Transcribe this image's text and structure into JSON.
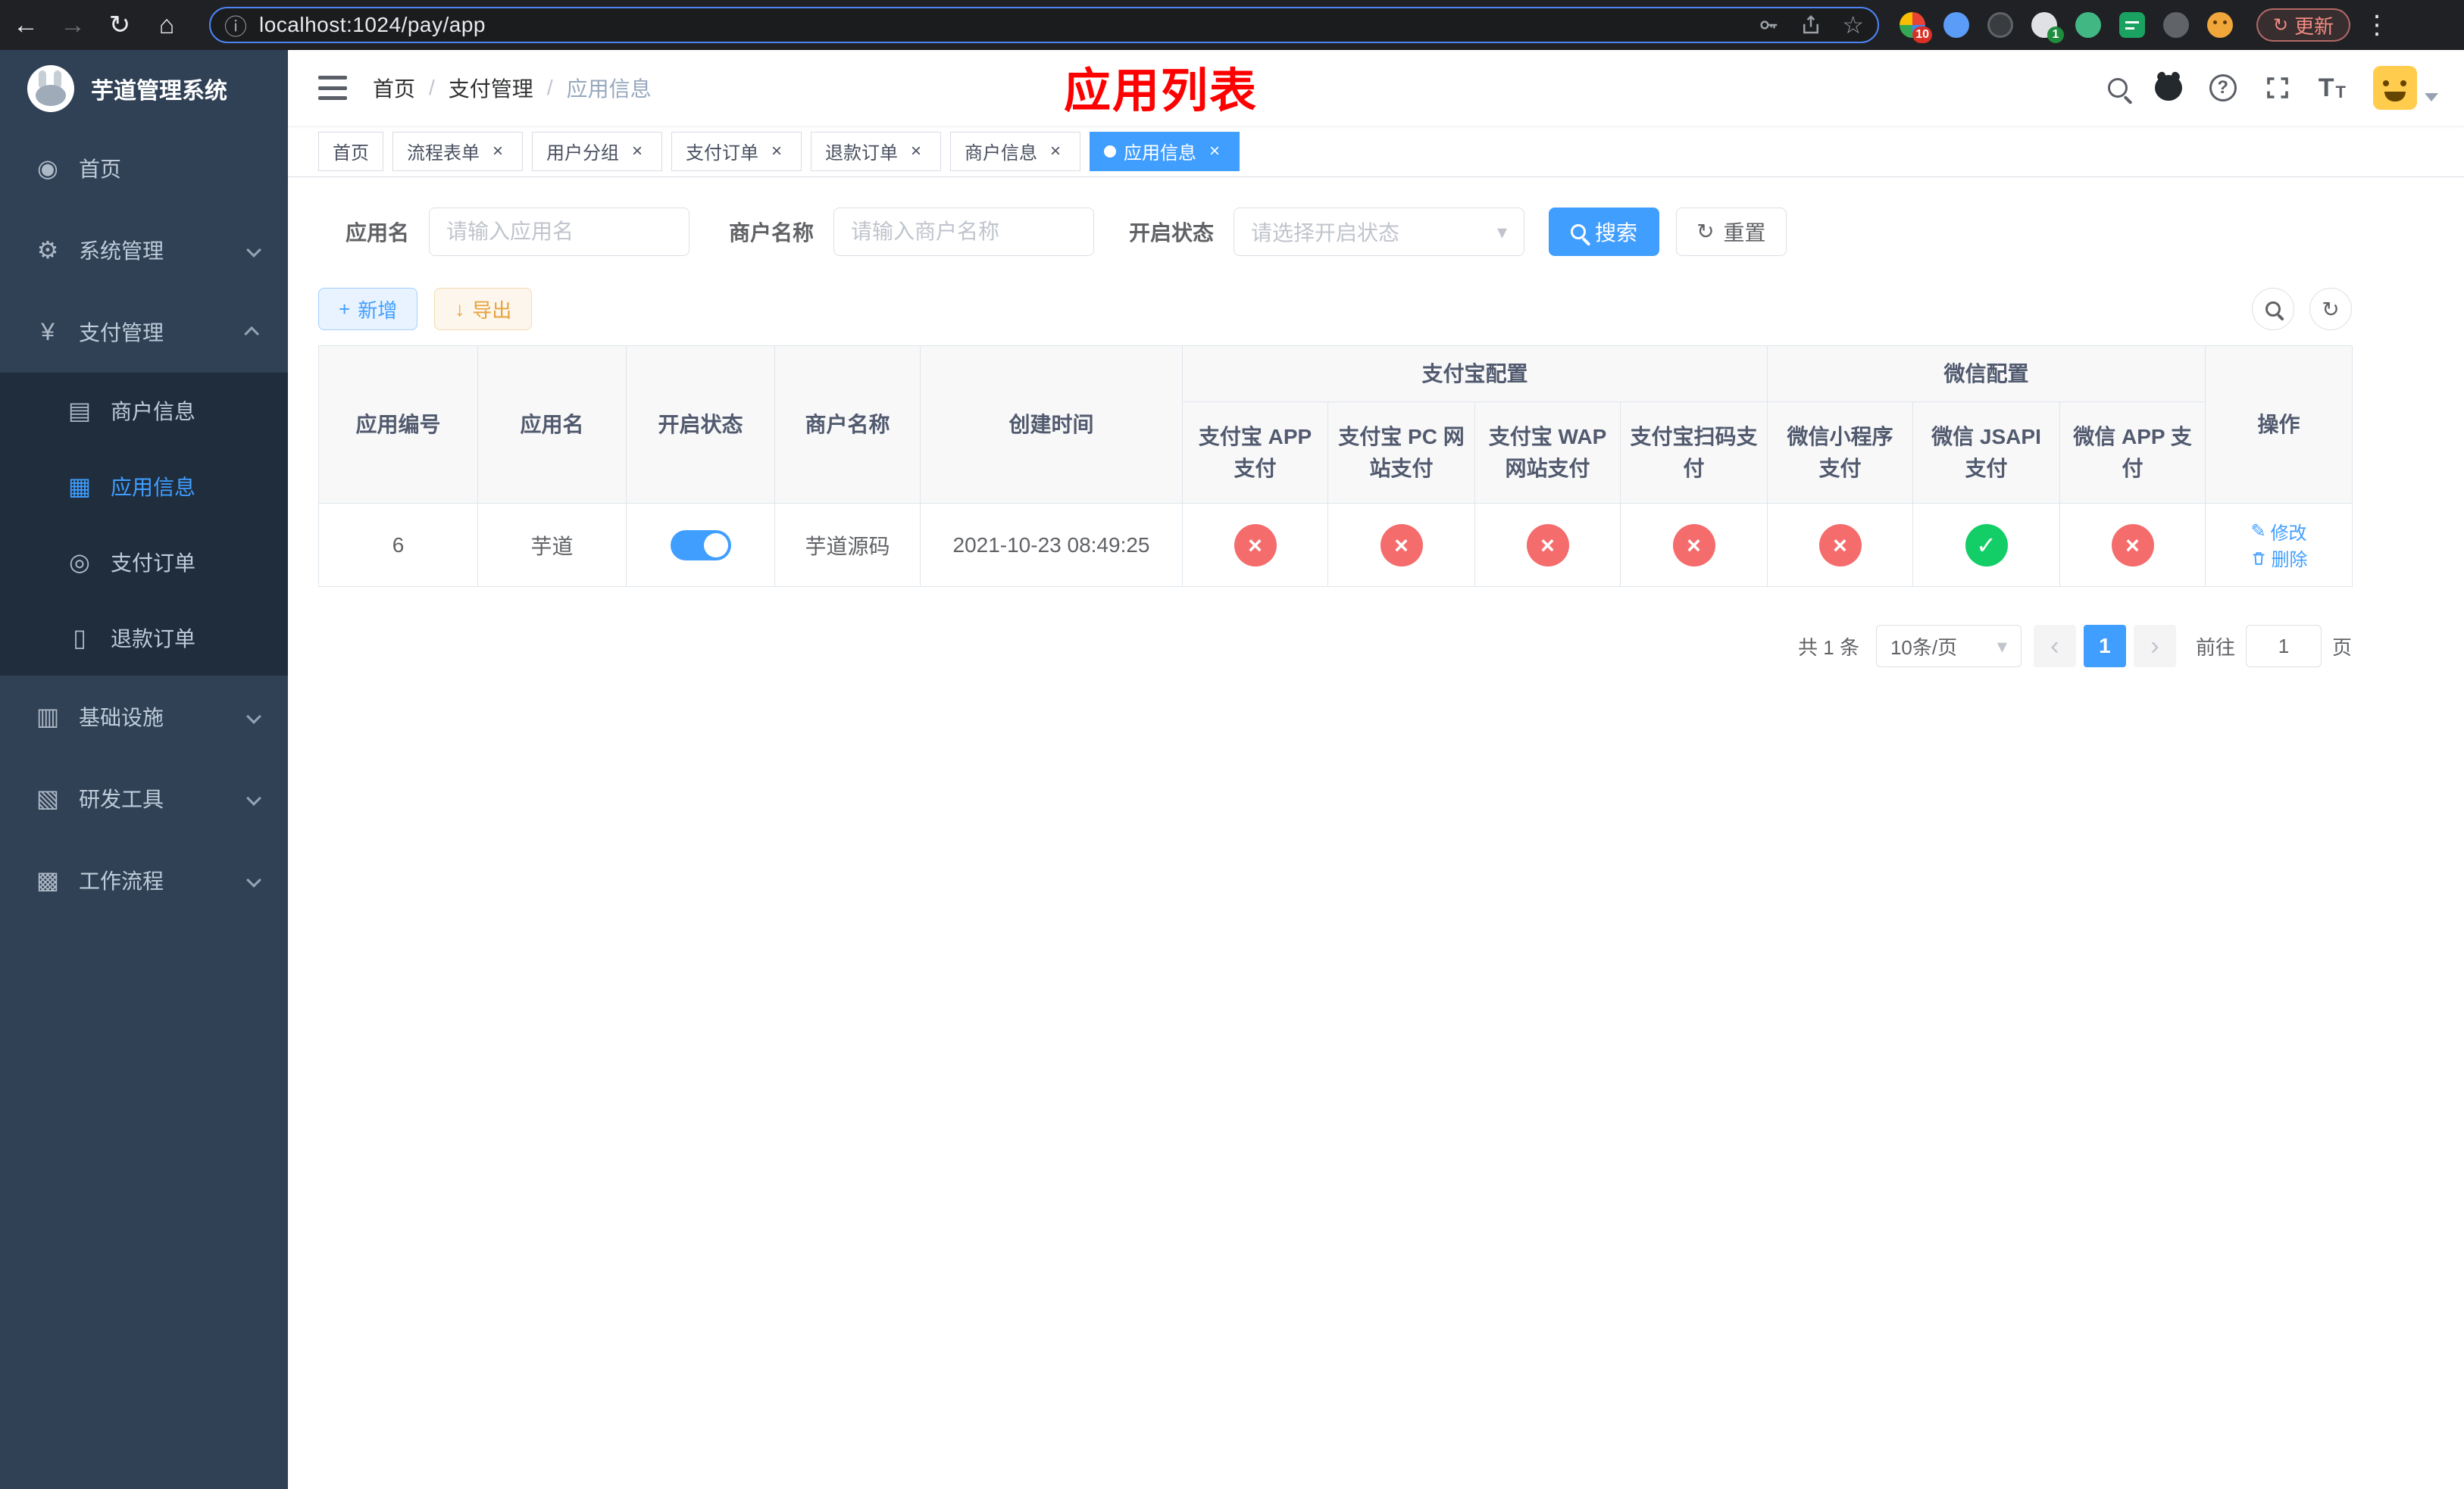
{
  "colors": {
    "primary": "#409eff",
    "success": "#13ce66",
    "danger": "#f56c6c",
    "warning": "#e6a23c",
    "sidebar_bg": "#304156",
    "submenu_bg": "#1f2d3d",
    "annotation": "#fe0000",
    "browser_bg": "#202124",
    "urlbar_focus_ring": "#4d84f4"
  },
  "icons": {
    "back": "←",
    "forward": "→",
    "refresh": "↻",
    "home": "⌂",
    "info": "ⓘ",
    "star": "☆",
    "menu_dots": "⋮",
    "close": "×",
    "check": "✓",
    "cross": "×",
    "plus": "+",
    "download": "↓",
    "question": "?",
    "font_size_large": "T",
    "font_size_small": "T",
    "caret": "▾",
    "chevron_left": "‹",
    "chevron_right": "›",
    "edit": "✎"
  },
  "browser": {
    "url": "localhost:1024/pay/app",
    "update_button": "更新",
    "extensions": [
      {
        "badge": "10"
      },
      {
        "badge": ""
      },
      {
        "badge": ""
      },
      {
        "badge": "1"
      },
      {
        "badge": ""
      },
      {
        "badge": ""
      },
      {
        "badge": ""
      },
      {
        "badge": ""
      }
    ]
  },
  "sidebar": {
    "title": "芋道管理系统",
    "home": {
      "icon": "◉",
      "label": "首页"
    },
    "system": {
      "icon": "⚙",
      "label": "系统管理"
    },
    "payment": {
      "icon": "¥",
      "label": "支付管理"
    },
    "merchant": {
      "icon": "▤",
      "label": "商户信息"
    },
    "app_info": {
      "icon": "▦",
      "label": "应用信息"
    },
    "pay_order": {
      "icon": "◎",
      "label": "支付订单"
    },
    "refund_order": {
      "icon": "▯",
      "label": "退款订单"
    },
    "infra": {
      "icon": "▥",
      "label": "基础设施"
    },
    "dev_tools": {
      "icon": "▧",
      "label": "研发工具"
    },
    "workflow": {
      "icon": "▩",
      "label": "工作流程"
    }
  },
  "breadcrumb": {
    "separator": "/",
    "items": [
      "首页",
      "支付管理",
      "应用信息"
    ]
  },
  "annotation": "应用列表",
  "tabs": [
    {
      "label": "首页",
      "closable": false,
      "active": false
    },
    {
      "label": "流程表单",
      "closable": true,
      "active": false
    },
    {
      "label": "用户分组",
      "closable": true,
      "active": false
    },
    {
      "label": "支付订单",
      "closable": true,
      "active": false
    },
    {
      "label": "退款订单",
      "closable": true,
      "active": false
    },
    {
      "label": "商户信息",
      "closable": true,
      "active": false
    },
    {
      "label": "应用信息",
      "closable": true,
      "active": true
    }
  ],
  "filter": {
    "app_name_label": "应用名",
    "app_name_placeholder": "请输入应用名",
    "merchant_label": "商户名称",
    "merchant_placeholder": "请输入商户名称",
    "status_label": "开启状态",
    "status_placeholder": "请选择开启状态",
    "search_button": "搜索",
    "reset_button": "重置"
  },
  "toolbar": {
    "add_button": "新增",
    "export_button": "导出"
  },
  "table": {
    "headers": {
      "app_id": "应用编号",
      "app_name": "应用名",
      "status": "开启状态",
      "merchant_name": "商户名称",
      "create_time": "创建时间",
      "alipay_group": "支付宝配置",
      "alipay_app": "支付宝 APP 支付",
      "alipay_pc": "支付宝 PC 网站支付",
      "alipay_wap": "支付宝 WAP 网站支付",
      "alipay_qr": "支付宝扫码支付",
      "wechat_group": "微信配置",
      "wechat_mini": "微信小程序支付",
      "wechat_jsapi": "微信 JSAPI 支付",
      "wechat_app": "微信 APP 支付",
      "actions": "操作"
    },
    "rows": [
      {
        "id": "6",
        "name": "芋道",
        "enabled": true,
        "merchant": "芋道源码",
        "created": "2021-10-23 08:49:25",
        "configs": [
          "cross",
          "cross",
          "cross",
          "cross",
          "cross",
          "check",
          "cross"
        ],
        "edit_label": "修改",
        "delete_label": "删除"
      }
    ]
  },
  "pagination": {
    "total": "共 1 条",
    "page_size": "10条/页",
    "page": "1",
    "goto_label": "前往",
    "goto_value": "1",
    "page_unit": "页"
  }
}
